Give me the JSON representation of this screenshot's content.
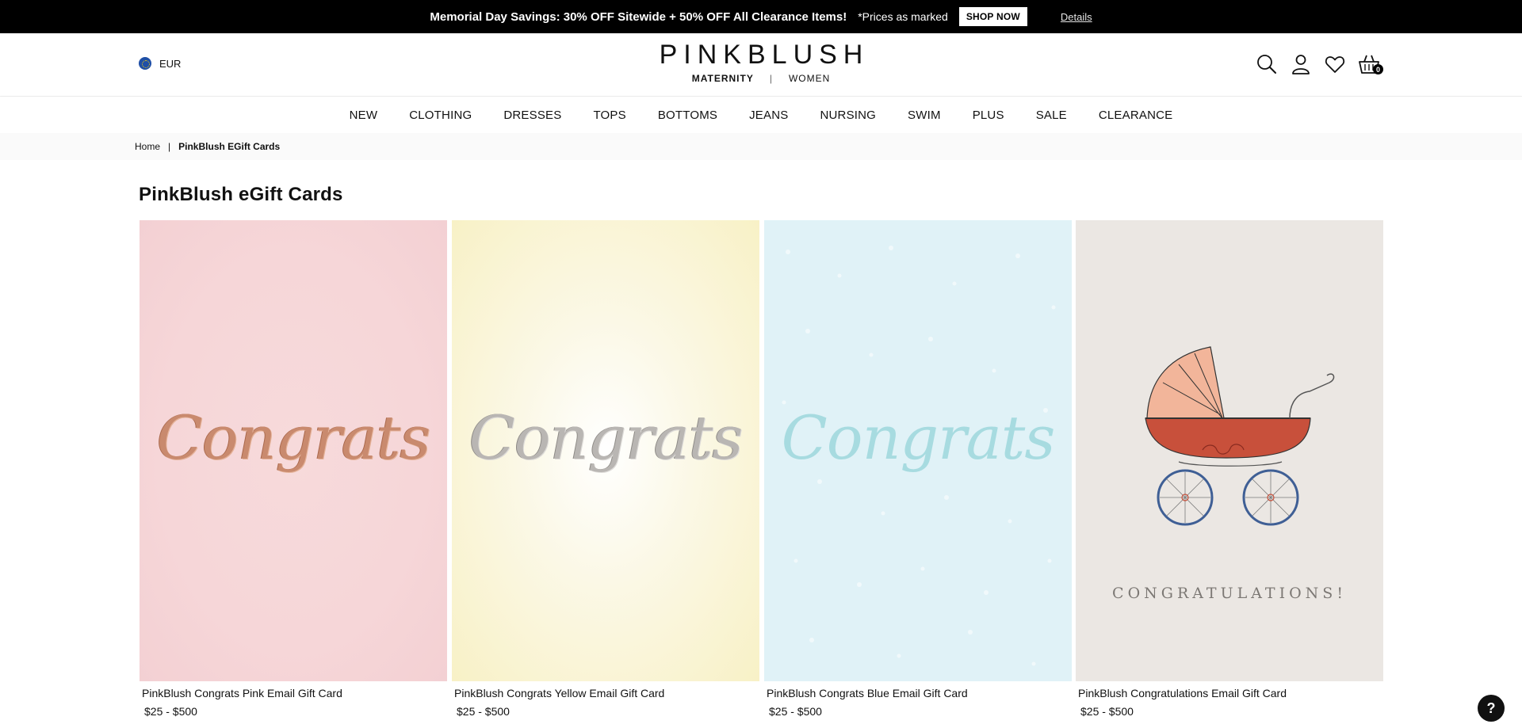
{
  "promo": {
    "headline": "Memorial Day Savings: 30% OFF Sitewide + 50% OFF All Clearance Items!",
    "note": "*Prices as marked",
    "shop_now": "SHOP NOW",
    "details": "Details"
  },
  "header": {
    "currency": "EUR",
    "logo": {
      "wordmark": "PINKBLUSH",
      "maternity": "MATERNITY",
      "divider": "|",
      "women": "WOMEN"
    },
    "icons": [
      "search-icon",
      "account-icon",
      "wishlist-icon",
      "cart-icon"
    ],
    "cart_count": "0"
  },
  "nav": {
    "items": [
      "NEW",
      "CLOTHING",
      "DRESSES",
      "TOPS",
      "BOTTOMS",
      "JEANS",
      "NURSING",
      "SWIM",
      "PLUS",
      "SALE",
      "CLEARANCE"
    ]
  },
  "breadcrumb": {
    "home": "Home",
    "separator": "|",
    "current": "PinkBlush EGift Cards"
  },
  "page": {
    "title": "PinkBlush eGift Cards"
  },
  "products": [
    {
      "name": "PinkBlush Congrats Pink Email Gift Card",
      "price": "$25 - $500",
      "card_text": "Congrats",
      "bg_color": "#f6d6d8"
    },
    {
      "name": "PinkBlush Congrats Yellow Email Gift Card",
      "price": "$25 - $500",
      "card_text": "Congrats",
      "bg_color": "#f8f1c6"
    },
    {
      "name": "PinkBlush Congrats Blue Email Gift Card",
      "price": "$25 - $500",
      "card_text": "Congrats",
      "bg_color": "#e0f2f7"
    },
    {
      "name": "PinkBlush Congratulations Email Gift Card",
      "price": "$25 - $500",
      "card_text": "CONGRATULATIONS!",
      "bg_color": "#ebe7e3"
    }
  ],
  "help": {
    "label": "?"
  }
}
